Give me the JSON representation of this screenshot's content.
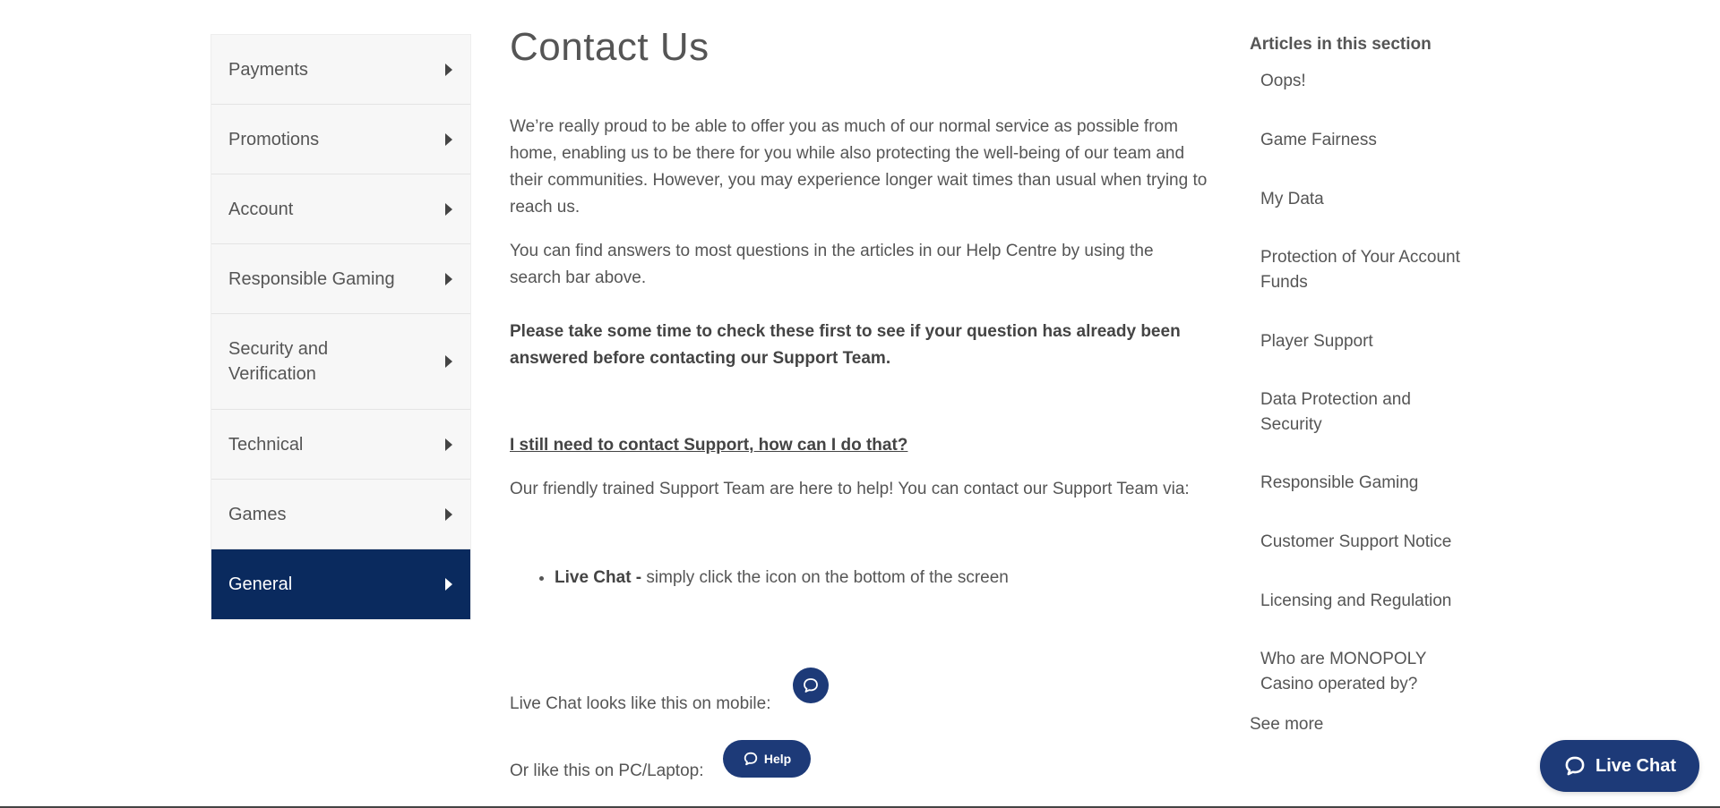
{
  "sidebar": {
    "items": [
      {
        "label": "Payments"
      },
      {
        "label": "Promotions"
      },
      {
        "label": "Account"
      },
      {
        "label": "Responsible Gaming"
      },
      {
        "label": "Security and Verification"
      },
      {
        "label": "Technical"
      },
      {
        "label": "Games"
      },
      {
        "label": "General",
        "active": true
      }
    ]
  },
  "article": {
    "title": "Contact Us",
    "paragraph1": "We’re really proud to be able to offer you as much of our normal service as possible from home, enabling us to be there for you while also protecting the well-being of our team and their communities. However, you may experience longer wait times than usual when trying to reach us.",
    "paragraph2": "You can find answers to most questions in the articles in our Help Centre by using the search bar above.",
    "paragraph3": "Please take some time to check these first to see if your question has already been answered before contacting our Support Team.",
    "question": "I still need to contact Support, how can I do that?",
    "paragraph4": "Our friendly trained Support Team are here to help! You can contact our Support Team via:",
    "bullet_bold": "Live Chat -",
    "bullet_text": " simply click the icon on the bottom of the screen",
    "mobile_text": "Live Chat looks like this on mobile:",
    "pc_text": "Or like this on PC/Laptop:",
    "help_button_label": "Help"
  },
  "related": {
    "heading": "Articles in this section",
    "items": [
      {
        "label": "Oops!"
      },
      {
        "label": "Game Fairness"
      },
      {
        "label": "My Data"
      },
      {
        "label": "Protection of Your Account Funds"
      },
      {
        "label": "Player Support"
      },
      {
        "label": "Data Protection and Security"
      },
      {
        "label": "Responsible Gaming"
      },
      {
        "label": "Customer Support Notice"
      },
      {
        "label": "Licensing and Regulation"
      },
      {
        "label": "Who are MONOPOLY Casino operated by?"
      }
    ],
    "see_more": "See more"
  },
  "live_chat": {
    "label": "Live Chat"
  },
  "colors": {
    "brand_navy": "#0a2a5e",
    "chat_blue": "#1d3a78",
    "text": "#555555"
  },
  "icons": {
    "nav_arrow": "caret-right-icon",
    "chat": "chat-bubble-icon"
  }
}
